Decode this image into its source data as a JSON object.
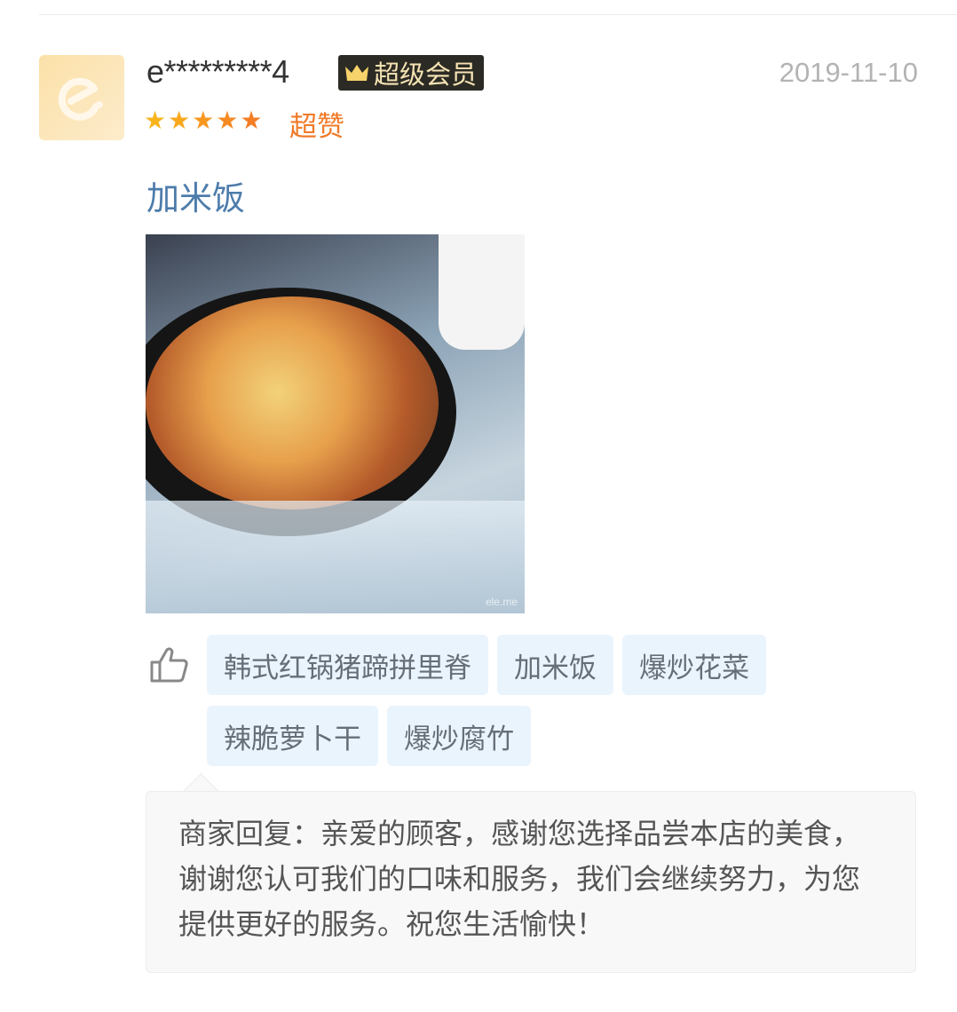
{
  "review": {
    "username": "e*********4",
    "badge": {
      "label": "超级会员",
      "icon": "crown-icon",
      "color": "#2b2a24"
    },
    "date": "2019-11-10",
    "rating": 5,
    "rating_max": 5,
    "rating_text": "超赞",
    "dish": "加米饭",
    "photo_watermark": "ele.me",
    "liked_dishes": [
      "韩式红锅猪蹄拼里脊",
      "加米饭",
      "爆炒花菜",
      "辣脆萝卜干",
      "爆炒腐竹"
    ],
    "merchant_reply": "商家回复：亲爱的顾客，感谢您选择品尝本店的美食，谢谢您认可我们的口味和服务，我们会继续努力，为您提供更好的服务。祝您生活愉快！"
  },
  "colors": {
    "star": "#f7a21b",
    "rating_text": "#f07a28",
    "dish": "#4d7cab",
    "tag_bg": "#eaf4fd"
  }
}
